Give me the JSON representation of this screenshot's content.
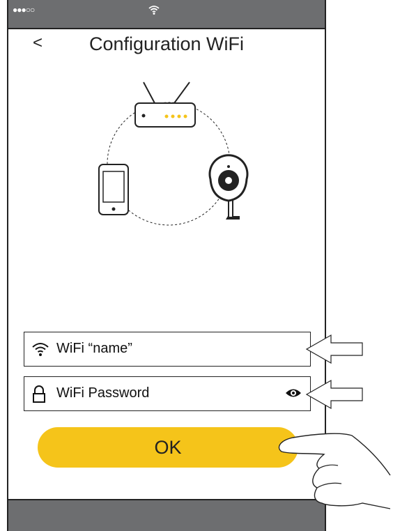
{
  "status_bar": {
    "signal_dots": "●●●○○",
    "wifi_icon": "wifi-icon"
  },
  "header": {
    "back_label": "<",
    "title": "Configuration WiFi"
  },
  "illustration": {
    "router_led_color": "#f5c41a",
    "devices": [
      "router-icon",
      "smartphone-icon",
      "camera-icon"
    ]
  },
  "form": {
    "ssid": {
      "icon": "wifi-icon",
      "value": "WiFi “name”"
    },
    "password": {
      "icon": "lock-icon",
      "value": "WiFi Password",
      "toggle_icon": "eye-icon"
    }
  },
  "ok_button": {
    "label": "OK",
    "color": "#f5c41a"
  },
  "colors": {
    "bars": "#6d6e70",
    "accent": "#f5c41a",
    "text": "#222222"
  }
}
